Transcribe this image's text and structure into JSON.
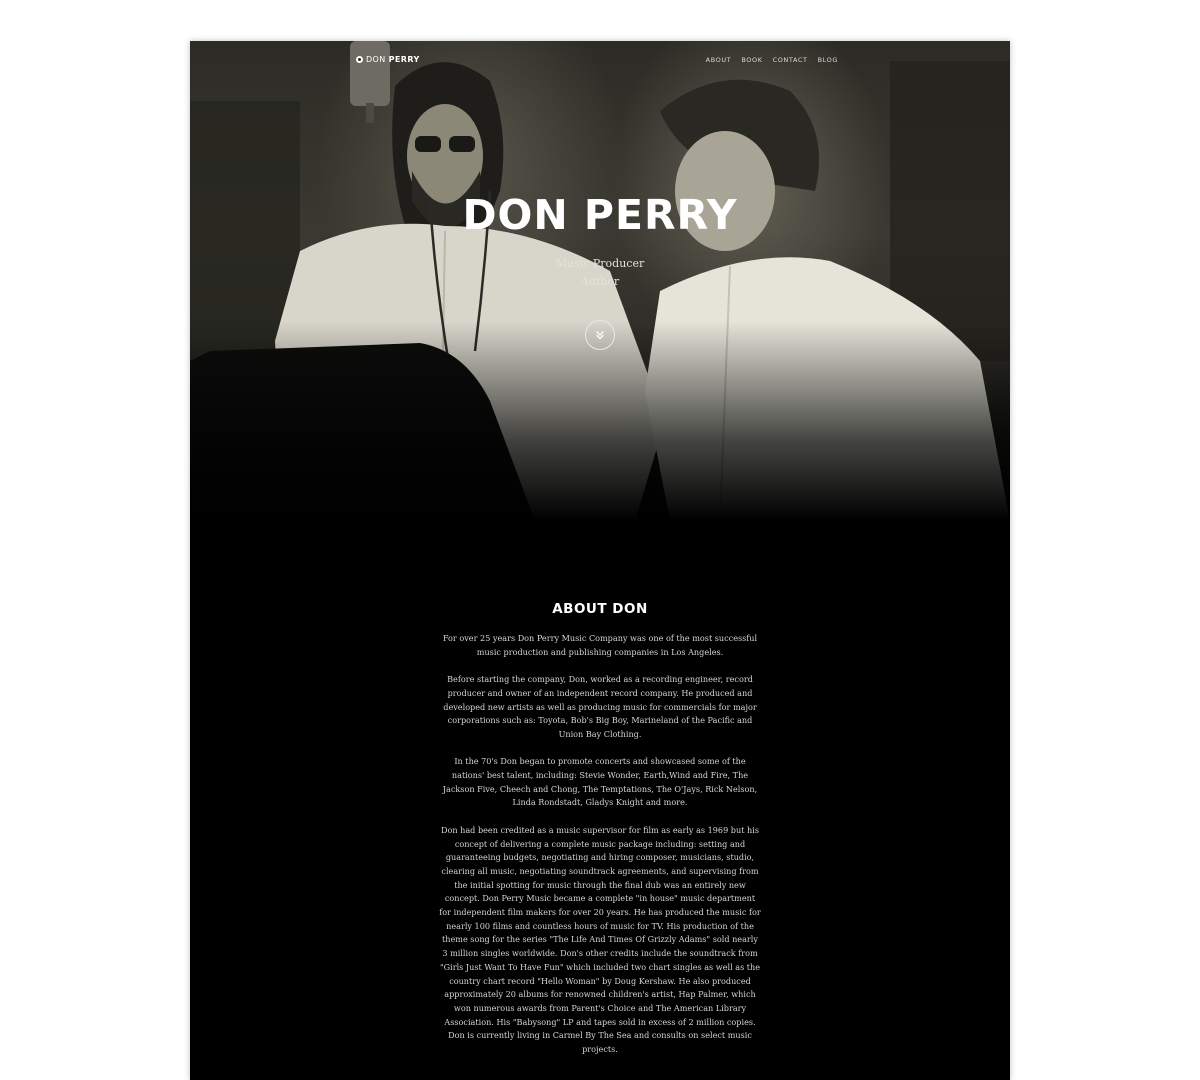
{
  "brand": {
    "first": "DON",
    "second": "PERRY"
  },
  "nav": {
    "items": [
      "ABOUT",
      "BOOK",
      "CONTACT",
      "BLOG"
    ]
  },
  "hero": {
    "title": "DON PERRY",
    "subtitles": [
      "Music Producer",
      "Author"
    ],
    "scroll_icon": "chevron-double-down-icon"
  },
  "about": {
    "title": "ABOUT DON",
    "paragraphs": [
      "For over 25 years Don Perry Music Company was one of the most successful music production and publishing companies in Los Angeles.",
      "Before starting the company, Don, worked as a recording engineer, record producer and owner of an independent record company. He produced and developed new artists as well as producing music for commercials for major corporations such as: Toyota, Bob's Big Boy, Marineland of the Pacific and Union Bay Clothing.",
      "In the 70's Don began to promote concerts and showcased some of the nations' best talent, including: Stevie Wonder, Earth,Wind and Fire, The Jackson Five, Cheech and Chong, The Temptations, The O'Jays, Rick Nelson, Linda Rondstadt, Gladys Knight and more.",
      "Don had been credited as a music supervisor for film as early as 1969 but his concept of delivering a complete music package including: setting and guaranteeing budgets, negotiating and hiring composer, musicians, studio, clearing all music, negotiating soundtrack agreements, and supervising from the initial spotting for music through the final dub was an entirely new concept. Don Perry Music became a complete \"in house\" music department for independent film makers for over 20 years. He has produced the music for nearly 100 films and countless hours of music for TV. His production of the theme song for the series \"The Life And Times Of Grizzly Adams\" sold nearly 3 million singles worldwide. Don's other credits include the soundtrack from \"Girls Just Want To Have Fun\" which included two chart singles as well as the country chart record \"Hello Woman\" by Doug Kershaw. He also produced approximately 20 albums for renowned children's artist, Hap Palmer, which won numerous awards from Parent's Choice and The American Library Association. His \"Babysong\" LP and tapes sold in excess of 2 million copies. Don is currently living in Carmel By The Sea and consults on select music projects."
    ]
  },
  "colors": {
    "page_bg": "#ffffff",
    "section_bg": "#000000",
    "text_light": "#d6d6d0"
  }
}
